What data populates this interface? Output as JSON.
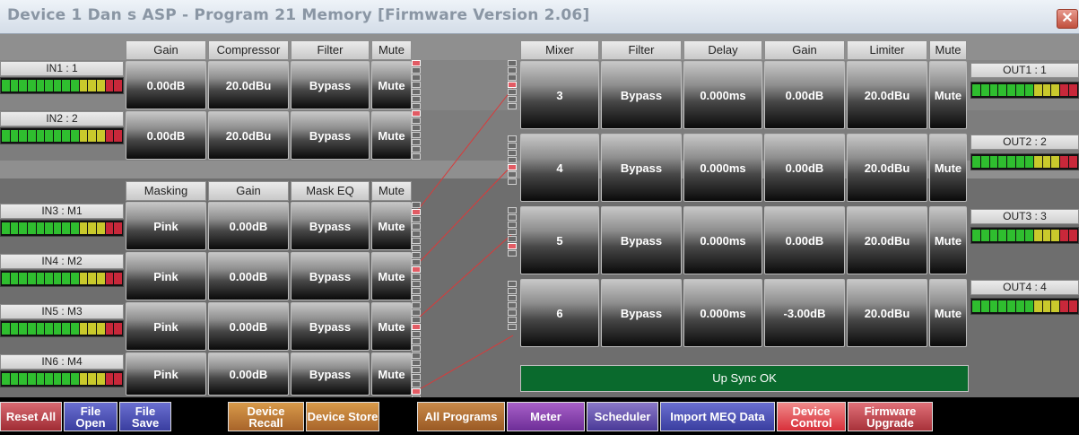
{
  "window": {
    "title": "Device 1 Dan s ASP  -  Program 21  Memory [Firmware Version 2.06]",
    "close_symbol": "✕"
  },
  "input_section": {
    "headers_top": [
      "Gain",
      "Compressor",
      "Filter",
      "Mute"
    ],
    "headers_bottom": [
      "Masking",
      "Gain",
      "Mask EQ",
      "Mute"
    ],
    "channels": [
      {
        "label": "IN1 : 1",
        "gain": "0.00dB",
        "compressor": "20.0dBu",
        "filter": "Bypass",
        "mute": "Mute"
      },
      {
        "label": "IN2 : 2",
        "gain": "0.00dB",
        "compressor": "20.0dBu",
        "filter": "Bypass",
        "mute": "Mute"
      }
    ],
    "masking": [
      {
        "label": "IN3 : M1",
        "masking": "Pink",
        "gain": "0.00dB",
        "mask_eq": "Bypass",
        "mute": "Mute"
      },
      {
        "label": "IN4 : M2",
        "masking": "Pink",
        "gain": "0.00dB",
        "mask_eq": "Bypass",
        "mute": "Mute"
      },
      {
        "label": "IN5 : M3",
        "masking": "Pink",
        "gain": "0.00dB",
        "mask_eq": "Bypass",
        "mute": "Mute"
      },
      {
        "label": "IN6 : M4",
        "masking": "Pink",
        "gain": "0.00dB",
        "mask_eq": "Bypass",
        "mute": "Mute"
      }
    ]
  },
  "output_section": {
    "headers": [
      "Mixer",
      "Filter",
      "Delay",
      "Gain",
      "Limiter",
      "Mute"
    ],
    "channels": [
      {
        "label": "OUT1 : 1",
        "mixer": "3",
        "filter": "Bypass",
        "delay": "0.000ms",
        "gain": "0.00dB",
        "limiter": "20.0dBu",
        "mute": "Mute"
      },
      {
        "label": "OUT2 : 2",
        "mixer": "4",
        "filter": "Bypass",
        "delay": "0.000ms",
        "gain": "0.00dB",
        "limiter": "20.0dBu",
        "mute": "Mute"
      },
      {
        "label": "OUT3 : 3",
        "mixer": "5",
        "filter": "Bypass",
        "delay": "0.000ms",
        "gain": "0.00dB",
        "limiter": "20.0dBu",
        "mute": "Mute"
      },
      {
        "label": "OUT4 : 4",
        "mixer": "6",
        "filter": "Bypass",
        "delay": "0.000ms",
        "gain": "-3.00dB",
        "limiter": "20.0dBu",
        "mute": "Mute"
      }
    ]
  },
  "status": {
    "text": "Up Sync OK"
  },
  "toolbar": {
    "reset_all": "Reset All",
    "file_open": "File Open",
    "file_save": "File Save",
    "device_recall": "Device Recall",
    "device_store": "Device Store",
    "all_programs": "All Programs",
    "meter": "Meter",
    "scheduler": "Scheduler",
    "import_meq": "Import MEQ Data",
    "device_control": "Device Control",
    "firmware_upgrade": "Firmware Upgrade"
  },
  "colors": {
    "meter_green": "#2fbe2f",
    "meter_yellow": "#c9c92c",
    "meter_red": "#c8283a",
    "status_green": "#0a6a2d",
    "wire_red": "#d93a3a"
  }
}
